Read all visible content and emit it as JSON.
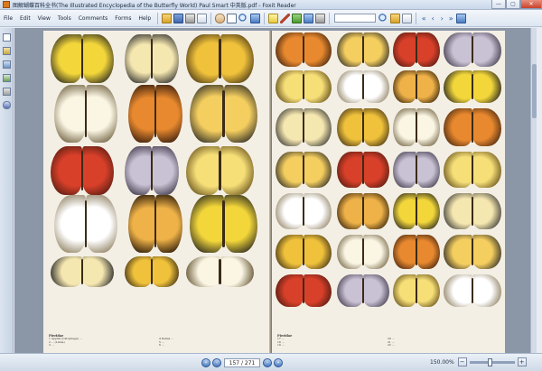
{
  "window": {
    "title": "图解蝴蝶百科全书(The Illustrated Encyclopedia of the Butterfly World) Paul Smart 中英版.pdf - Foxit Reader",
    "minimize": "—",
    "maximize": "▢",
    "close": "✕"
  },
  "menu": [
    "File",
    "Edit",
    "View",
    "Tools",
    "Comments",
    "Forms",
    "Help"
  ],
  "toolbar": {
    "icons": [
      "open-icon",
      "save-icon",
      "print-icon",
      "email-icon",
      "hand-tool-icon",
      "select-text-icon",
      "zoom-icon",
      "note-icon",
      "pen-icon",
      "stamp-icon",
      "find-icon"
    ],
    "search_placeholder": ""
  },
  "sidebar": {
    "icons": [
      "bookmarks-icon",
      "pages-icon",
      "layers-icon",
      "attachments-icon",
      "signatures-icon",
      "comments-icon"
    ]
  },
  "document": {
    "left_caption_heading": "Pieridae",
    "right_caption_heading": "Pieridae",
    "left_caption_lines": [
      "1 Appias (Catophaga) ...",
      "2 ... (Linné)",
      "3 ...",
      "4 Delias ...",
      "5 ...",
      "6 ..."
    ],
    "right_caption_lines": [
      "17 ...",
      "18 ...",
      "19 ...",
      "20 ...",
      "21 ...",
      "22 ..."
    ]
  },
  "statusbar": {
    "page_display": "157 / 271",
    "zoom_value": "150.00%",
    "zoom_out": "−",
    "zoom_in": "+"
  }
}
